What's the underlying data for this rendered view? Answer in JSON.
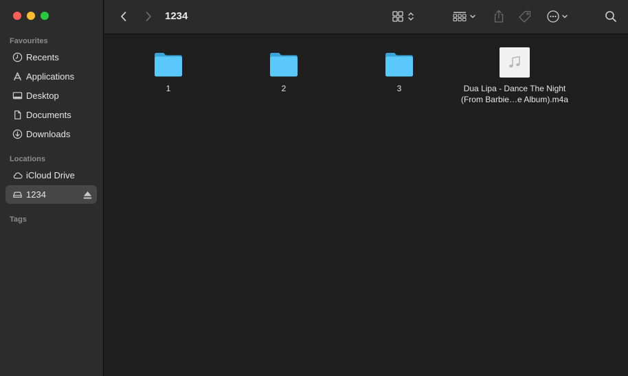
{
  "window": {
    "title": "1234"
  },
  "sidebar": {
    "favourites_title": "Favourites",
    "favourites": [
      {
        "label": "Recents",
        "icon": "clock-icon"
      },
      {
        "label": "Applications",
        "icon": "applications-icon"
      },
      {
        "label": "Desktop",
        "icon": "desktop-icon"
      },
      {
        "label": "Documents",
        "icon": "document-icon"
      },
      {
        "label": "Downloads",
        "icon": "download-icon"
      }
    ],
    "locations_title": "Locations",
    "locations": [
      {
        "label": "iCloud Drive",
        "icon": "cloud-icon"
      },
      {
        "label": "1234",
        "icon": "drive-icon",
        "selected": true,
        "ejectable": true
      }
    ],
    "tags_title": "Tags"
  },
  "toolbar": {
    "back_icon": "chevron-left-icon",
    "forward_icon": "chevron-right-icon",
    "view_icon": "grid-view-icon",
    "group_icon": "group-icon",
    "share_icon": "share-icon",
    "tag_icon": "tag-icon",
    "more_icon": "ellipsis-circle-icon",
    "search_icon": "search-icon"
  },
  "items": [
    {
      "label": "1",
      "type": "folder"
    },
    {
      "label": "2",
      "type": "folder"
    },
    {
      "label": "3",
      "type": "folder"
    },
    {
      "label_line1": "Dua Lipa - Dance The Night",
      "label_line2": "(From Barbie…e Album).m4a",
      "type": "audio-file"
    }
  ],
  "colors": {
    "folder": "#5ac8fa",
    "folder_dark": "#3aa3d9",
    "selected_bg": "#464646"
  }
}
